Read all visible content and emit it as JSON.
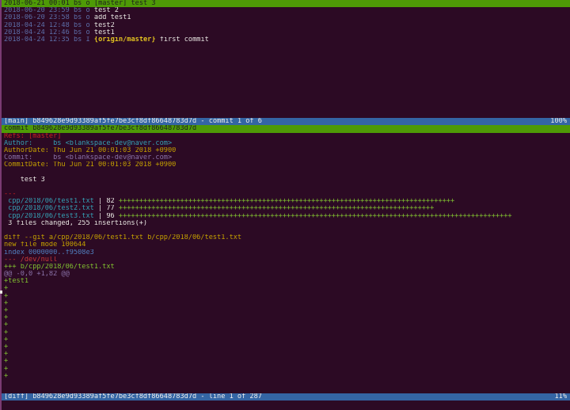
{
  "log": {
    "selected": {
      "date": "2018-06-21 00:01",
      "author": "bs",
      "marker": "o",
      "refs": "[master]",
      "message": "test 3"
    },
    "rows": [
      {
        "date": "2018-06-20 23:59",
        "author": "bs",
        "marker": "o",
        "message": "test 2"
      },
      {
        "date": "2018-06-20 23:58",
        "author": "bs",
        "marker": "o",
        "message": "add test1"
      },
      {
        "date": "2018-04-24 12:48",
        "author": "bs",
        "marker": "o",
        "message": "test2"
      },
      {
        "date": "2018-04-24 12:46",
        "author": "bs",
        "marker": "o",
        "message": "test1"
      },
      {
        "date": "2018-04-24 12:35",
        "author": "bs",
        "marker": "I",
        "refs": "{origin/master}",
        "message": "first commit"
      }
    ]
  },
  "main_status": {
    "left": "[main] b849628e9d93389af5fe7be3cf8df86648783d7d - commit 1 of 6",
    "right": "100%"
  },
  "commit_header": "commit b849628e9d93389af5fe7be3cf8df86648783d7d",
  "commit": {
    "refs": "Refs: [master]",
    "author": "Author:     bs <blankspace-dev@naver.com>",
    "author_date": "AuthorDate: Thu Jun 21 00:01:03 2018 +0900",
    "committer": "Commit:     bs <blankspace-dev@naver.com>",
    "commit_date": "CommitDate: Thu Jun 21 00:01:03 2018 +0900",
    "message": "    test 3",
    "separator": "---"
  },
  "stat": {
    "files": [
      {
        "path": " cpp/2018/06/test1.txt",
        "count": "82",
        "plus": 82
      },
      {
        "path": " cpp/2018/06/test2.txt",
        "count": "77",
        "plus": 77
      },
      {
        "path": " cpp/2018/06/test3.txt",
        "count": "96",
        "plus": 96
      }
    ],
    "summary": " 3 files changed, 255 insertions(+)"
  },
  "diff": {
    "header": "diff --git a/cpp/2018/06/test1.txt b/cpp/2018/06/test1.txt",
    "mode": "new file mode 100644",
    "index": "index 0000000..f9508e3",
    "minus_file": "--- /dev/null",
    "plus_file": "+++ b/cpp/2018/06/test1.txt",
    "hunk": "@@ -0,0 +1,82 @@",
    "first_line": "+test1",
    "plus_lines": 13
  },
  "diff_status": {
    "left": "[diff] b849628e9d93389af5fe7be3cf8df86648783d7d - line 1 of 287",
    "right": "11%"
  },
  "colors": {
    "background": "#2c0a24",
    "selected_row": "#4e9a06",
    "status_bar": "#3465a4"
  }
}
